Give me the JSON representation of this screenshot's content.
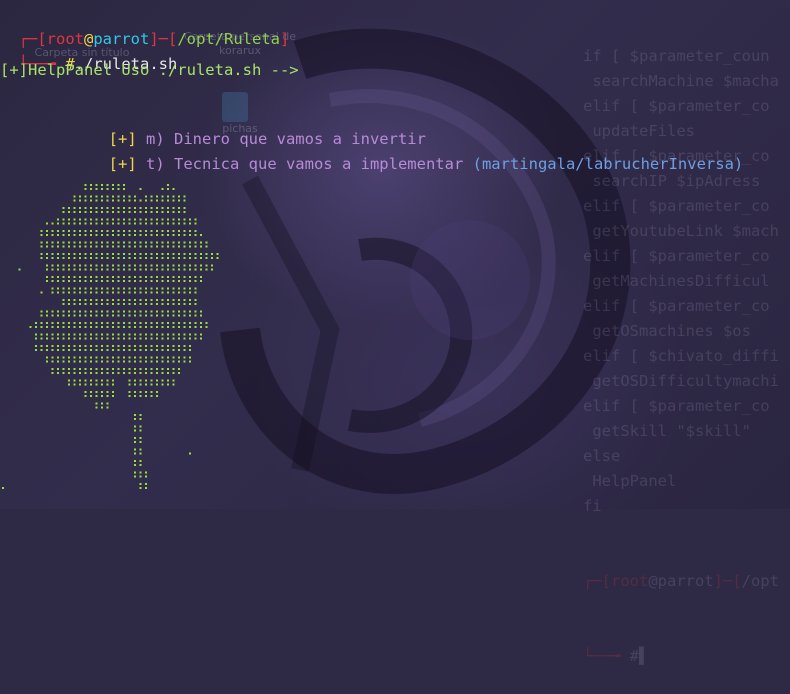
{
  "colors": {
    "red": "#e0353f",
    "cyan": "#33c7e8",
    "green": "#8fd14f",
    "yellow": "#f0d64a",
    "violet": "#b88ad8",
    "blue": "#6f9fe3",
    "clover": "#9be03a"
  },
  "desktop": {
    "icons": [
      {
        "label": "Carpeta personal de korarux",
        "icon": "folder-home-icon"
      },
      {
        "label": "Carpeta sin título",
        "icon": "folder-icon"
      },
      {
        "label": "pichas",
        "icon": "folder-icon"
      }
    ]
  },
  "prompt": {
    "bracket_open": "┌─[",
    "user": "root",
    "at": "@",
    "host": "parrot",
    "sep": "]─[",
    "path": "/opt/Ruleta",
    "bracket_close": "]",
    "arrow": "└──╼ ",
    "symbol": "#",
    "command": "./ruleta.sh"
  },
  "output": {
    "help_header": "[+]HelpPanel Uso ./ruleta.sh -->",
    "options": [
      {
        "marker": "[+]",
        "text": " m) Dinero que vamos a invertir",
        "extra": ""
      },
      {
        "marker": "[+]",
        "text": " t) Tecnica que vamos a implementar ",
        "extra": "(martingala/labrucherInversa)"
      }
    ]
  },
  "background_terminal": {
    "lines": [
      "if [ $parameter_coun",
      " searchMachine $macha",
      "elif [ $parameter_co",
      " updateFiles",
      "elif [ $parameter_co",
      " searchIP $ipAdress",
      "elif [ $parameter_co",
      " getYoutubeLink $mach",
      "elif [ $parameter_co",
      " getMachinesDifficul",
      "elif [ $parameter_co",
      " getOSmachines $os",
      "elif [ $chivato_diffi",
      " getOSDifficultymachi",
      "elif [ $parameter_co",
      " getSkill \"$skill\"",
      "else",
      " HelpPanel",
      "fi"
    ],
    "prompt_user": "root",
    "prompt_at": "@",
    "prompt_host": "parrot",
    "prompt_rest": "/opt",
    "prompt_symbol": "#"
  },
  "clover_art": {
    "rows": [
      "               ::::::::  .   .:.     ",
      "             ::::::::::::.::::::::   ",
      "           :::::::::::::::::::::::   ",
      "        ..:::::::::::::::::::::::::: ",
      "       :::::::::::::::::::::::::::::.",
      "       :::::::::::::::::::::::::::::::",
      "       :::::::::::::::::::::::::::::::::",
      "   .    :::::::::::::::::::::::::::::::",
      "        ::::::::::::::::::::::::::::: ",
      "       . :::::::::::::::::::::::::::  ",
      "           ::::::::::::::::::::::::: ",
      "       ::::::::::::::::::::::::::::::",
      "     .::::::::::::::::::::::::::::::::",
      "      ::::::::::::::::::::::::::::::: ",
      "      :::::::::::::::::::::::::::::  ",
      "        :::::::::::::::::::::::::::  ",
      "         ::::::::::::::::::::::::   ",
      "            :::::::::  :::::::::    ",
      "               ::::::  ::::::     ",
      "                 :::             ",
      "                        ::        ",
      "                        ::        ",
      "                        ::        ",
      "                        ::        .",
      "                        ::        ",
      "                        :::       ",
      ".                        ::       "
    ]
  }
}
